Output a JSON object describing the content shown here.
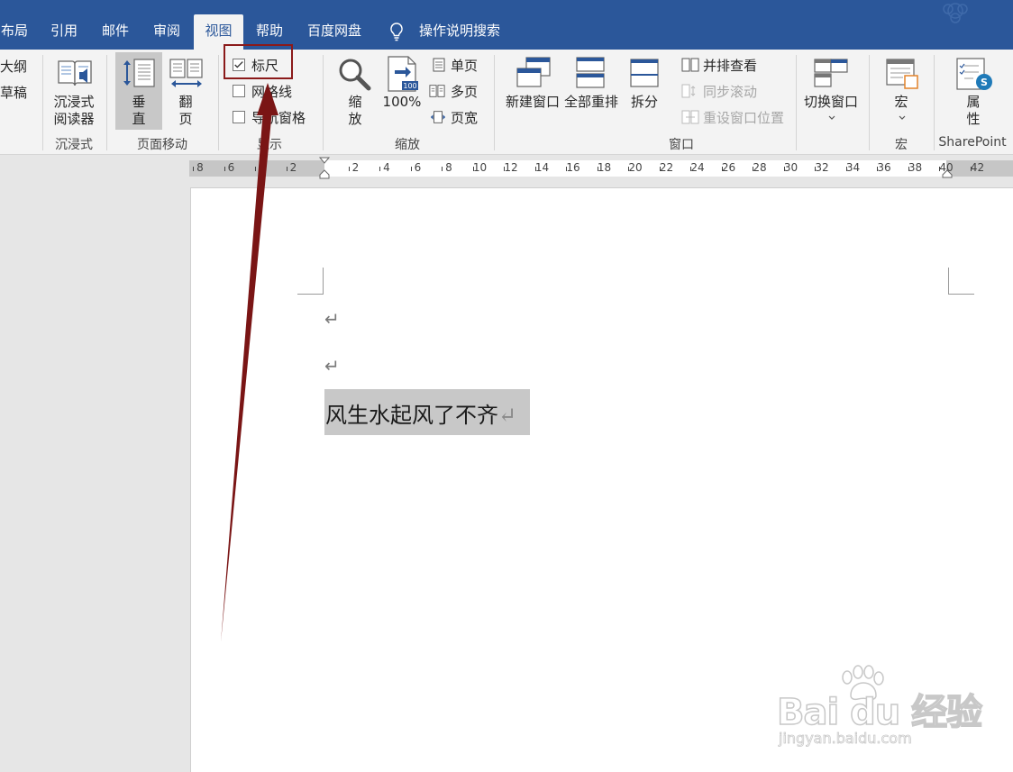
{
  "tabs": [
    {
      "label": "布局",
      "active": false
    },
    {
      "label": "引用",
      "active": false
    },
    {
      "label": "邮件",
      "active": false
    },
    {
      "label": "审阅",
      "active": false
    },
    {
      "label": "视图",
      "active": true
    },
    {
      "label": "帮助",
      "active": false
    },
    {
      "label": "百度网盘",
      "active": false
    }
  ],
  "tell_me": "操作说明搜索",
  "ribbon": {
    "views": {
      "outline": "大纲",
      "draft": "草稿"
    },
    "immersive": {
      "reader_line1": "沉浸式",
      "reader_line2": "阅读器",
      "group": "沉浸式"
    },
    "page_movement": {
      "vertical_1": "垂",
      "vertical_2": "直",
      "side_1": "翻",
      "side_2": "页",
      "group": "页面移动"
    },
    "show": {
      "ruler": "标尺",
      "ruler_checked": true,
      "gridlines": "网格线",
      "gridlines_checked": false,
      "nav_pane": "导航窗格",
      "nav_pane_checked": false,
      "group": "显示"
    },
    "zoom": {
      "zoom_1": "缩",
      "zoom_2": "放",
      "hundred": "100%",
      "one_page": "单页",
      "multi_page": "多页",
      "page_width": "页宽",
      "badge": "100",
      "group": "缩放"
    },
    "window": {
      "new_window": "新建窗口",
      "arrange_all": "全部重排",
      "split": "拆分",
      "side_by_side": "并排查看",
      "sync_scroll": "同步滚动",
      "reset_position": "重设窗口位置",
      "switch_windows": "切换窗口",
      "group": "窗口"
    },
    "macros": {
      "label": "宏",
      "group": "宏"
    },
    "sharepoint": {
      "prop_1": "属",
      "prop_2": "性",
      "group": "SharePoint"
    }
  },
  "ruler": {
    "left_labels": [
      "8",
      "6",
      "4",
      "2"
    ],
    "right_labels": [
      "2",
      "4",
      "6",
      "8",
      "10",
      "12",
      "14",
      "16",
      "18",
      "20",
      "22",
      "24",
      "26",
      "28",
      "30",
      "32",
      "34",
      "36",
      "38",
      "40",
      "42"
    ]
  },
  "document": {
    "paragraph_mark": "↵",
    "selected_text": "风生水起风了不齐"
  },
  "watermark": {
    "brand": "Bai du 经验",
    "url": "jingyan.baidu.com"
  },
  "colors": {
    "tab_bar": "#2b579a",
    "annotation": "#8b1a1a",
    "selection": "#c8c8c8"
  }
}
